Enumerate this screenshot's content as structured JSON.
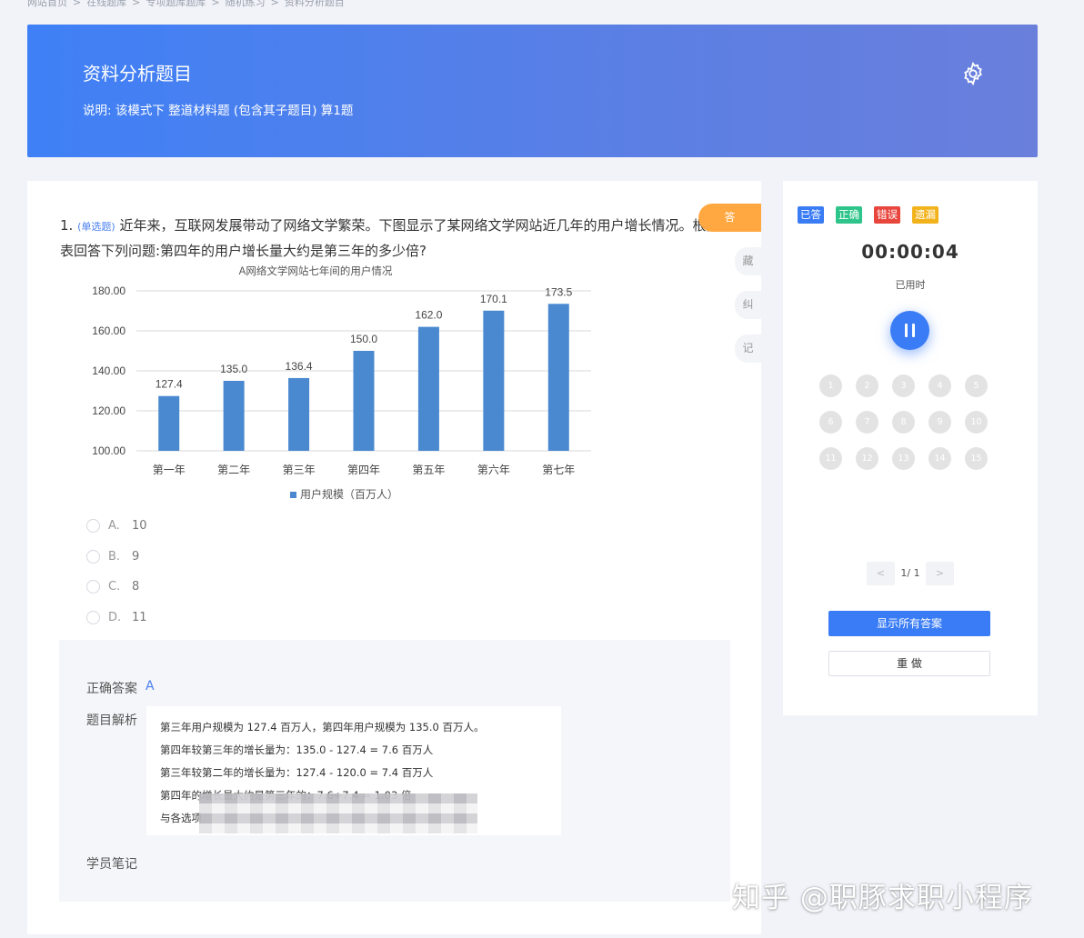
{
  "breadcrumb": [
    "网站首页",
    "在线题库",
    "专项题库题库",
    "随机练习",
    "资料分析题目"
  ],
  "banner": {
    "title": "资料分析题目",
    "description": "说明:   该模式下 整道材料题 (包含其子题目) 算1题"
  },
  "question": {
    "number": "1.",
    "type": "(单选题)",
    "text_line1": "近年来，互联网发展带动了网络文学繁荣。下图显示了某网络文学网站近几年的用户增长情况。根据",
    "text_line2": "表回答下列问题:第四年的用户增长量大约是第三年的多少倍?",
    "options": [
      {
        "letter": "A.",
        "value": "10"
      },
      {
        "letter": "B.",
        "value": "9"
      },
      {
        "letter": "C.",
        "value": "8"
      },
      {
        "letter": "D.",
        "value": "11"
      }
    ]
  },
  "side_tabs": {
    "answer": "答",
    "collect": "藏",
    "correct": "纠",
    "note": "记"
  },
  "chart_data": {
    "type": "bar",
    "title": "A网络文学网站七年间的用户情况",
    "categories": [
      "第一年",
      "第二年",
      "第三年",
      "第四年",
      "第五年",
      "第六年",
      "第七年"
    ],
    "series": [
      {
        "name": "用户规模（百万人）",
        "values": [
          127.4,
          135.0,
          136.4,
          150.0,
          162.0,
          170.1,
          173.5
        ]
      }
    ],
    "value_labels": [
      "127.4",
      "135.0",
      "136.4",
      "150.0",
      "162.0",
      "170.1",
      "173.5"
    ],
    "yticks": [
      "100.00",
      "120.00",
      "140.00",
      "160.00",
      "180.00"
    ],
    "ylim": [
      100,
      180
    ],
    "legend": "bottom",
    "grid": true,
    "bar_color": "#4a89d0"
  },
  "analysis": {
    "answer_label": "正确答案",
    "answer_value": "A",
    "explanation_label": "题目解析",
    "lines": [
      "第三年用户规模为 127.4 百万人，第四年用户规模为 135.0 百万人。",
      "第四年较第三年的增长量为：135.0 - 127.4 = 7.6 百万人",
      "第三年较第二年的增长量为：127.4 - 120.0 = 7.4 百万人",
      "第四年的增长量大约是第三年的：7.6÷7.4 ≈ 1.03 倍",
      "与各选项"
    ],
    "notes_label": "学员笔记"
  },
  "sidebar": {
    "tags": [
      {
        "label": "已答",
        "color": "#3a7cf5"
      },
      {
        "label": "正确",
        "color": "#2fc58a"
      },
      {
        "label": "错误",
        "color": "#e8453c"
      },
      {
        "label": "遗漏",
        "color": "#f2b21b"
      }
    ],
    "timer": "00:00:04",
    "timer_label": "已用时",
    "numbers": [
      "1",
      "2",
      "3",
      "4",
      "5",
      "6",
      "7",
      "8",
      "9",
      "10",
      "11",
      "12",
      "13",
      "14",
      "15"
    ],
    "pager": {
      "prev": "<",
      "text": "1/ 1",
      "next": ">"
    },
    "show_all_label": "显示所有答案",
    "redo_label": "重 做"
  },
  "watermark": "知乎 @职豚求职小程序"
}
